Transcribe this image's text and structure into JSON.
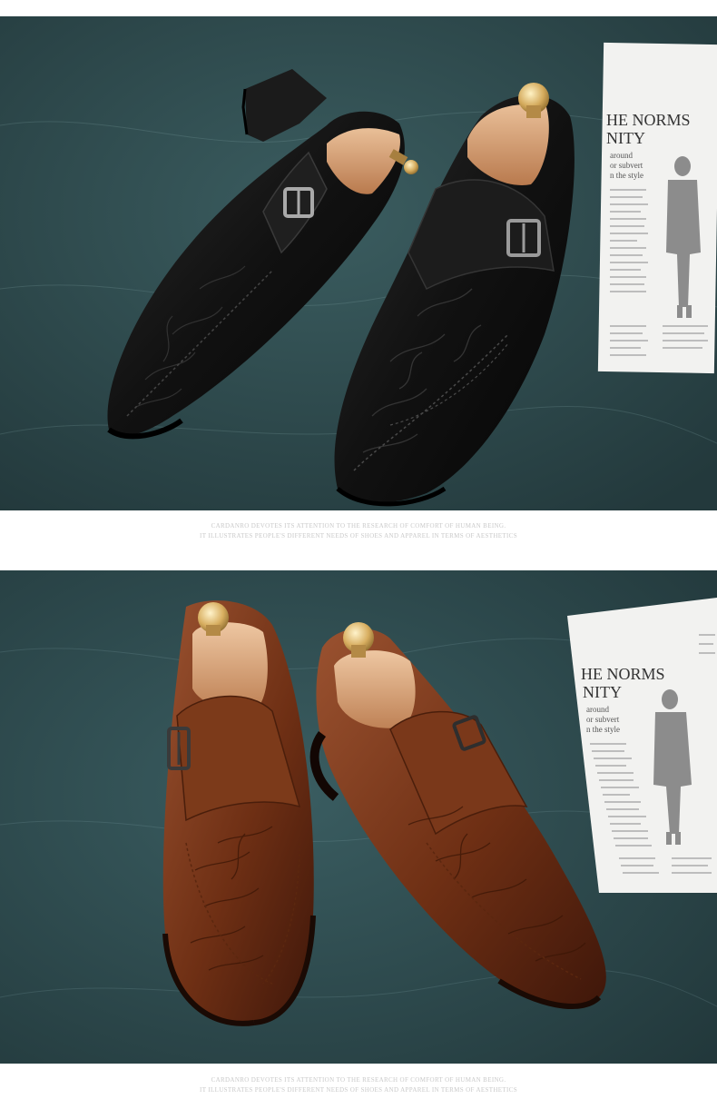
{
  "panels": [
    {
      "newspaper": {
        "headline_line1": "HE NORMS",
        "headline_line2": "NITY",
        "snippet_lines": [
          "around",
          "or subvert",
          "n the style"
        ]
      },
      "caption": {
        "line1": "CARDANRO DEVOTES ITS ATTENTION TO THE RESEARCH OF COMFORT OF HUMAN BEING.",
        "line2": "IT ILLUSTRATES PEOPLE'S DIFFERENT NEEDS OF SHOES AND APPAREL IN TERMS OF AESTHETICS"
      }
    },
    {
      "newspaper": {
        "headline_line1": "HE NORMS",
        "headline_line2": "NITY",
        "snippet_lines": [
          "around",
          "or subvert",
          "n the style"
        ]
      },
      "caption": {
        "line1": "CARDANRO DEVOTES ITS ATTENTION TO THE RESEARCH OF COMFORT OF HUMAN BEING.",
        "line2": "IT ILLUSTRATES PEOPLE'S DIFFERENT NEEDS OF SHOES AND APPAREL IN TERMS OF AESTHETICS"
      }
    }
  ],
  "colors": {
    "background": "#2f4f52",
    "black_leather": "#141414",
    "brown_leather": "#7a3a1a",
    "shoe_tree_wood": "#d8a37a",
    "brass": "#d9b56a",
    "newspaper": "#f2f2f0",
    "caption_text": "#c9c9c9"
  }
}
